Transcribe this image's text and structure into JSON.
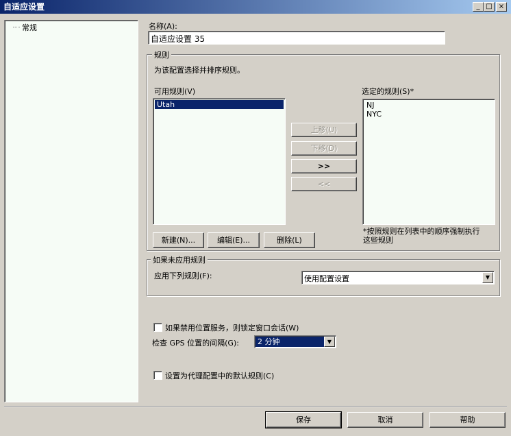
{
  "window": {
    "title": "自适应设置",
    "minimize": "_",
    "maximize": "□",
    "close": "×"
  },
  "tree": {
    "items": [
      {
        "label": "常规"
      }
    ]
  },
  "name_field": {
    "label": "名称(A):",
    "value": "自适应设置 35"
  },
  "rules_group": {
    "title": "规则",
    "description": "为该配置选择并排序规则。",
    "available_label": "可用规则(V)",
    "available_rules": [
      "Utah"
    ],
    "selected_label": "选定的规则(S)*",
    "selected_rules": [
      "NJ",
      "NYC"
    ],
    "move_up": "上移(U)",
    "move_down": "下移(D)",
    "add": ">>",
    "remove": "<<",
    "new_button": "新建(N)...",
    "edit_button": "编辑(E)...",
    "delete_button": "删除(L)",
    "note_line1": "*按照规则在列表中的顺序强制执行",
    "note_line2": "这些规则"
  },
  "fallback_group": {
    "title": "如果未应用规则",
    "apply_label": "应用下列规则(F):",
    "apply_value": "使用配置设置"
  },
  "options": {
    "lock_session_label": "如果禁用位置服务，则锁定窗口会话(W)",
    "lock_session_checked": false,
    "gps_interval_label": "检查 GPS 位置的间隔(G):",
    "gps_interval_value": "2 分钟",
    "default_rule_label": "设置为代理配置中的默认规则(C)",
    "default_rule_checked": false
  },
  "footer": {
    "save": "保存",
    "cancel": "取消",
    "help": "帮助"
  },
  "colors": {
    "title_bar": "#0a246a",
    "selection": "#0a246a",
    "face": "#d4d0c8",
    "list_background": "#f6fcf6"
  }
}
